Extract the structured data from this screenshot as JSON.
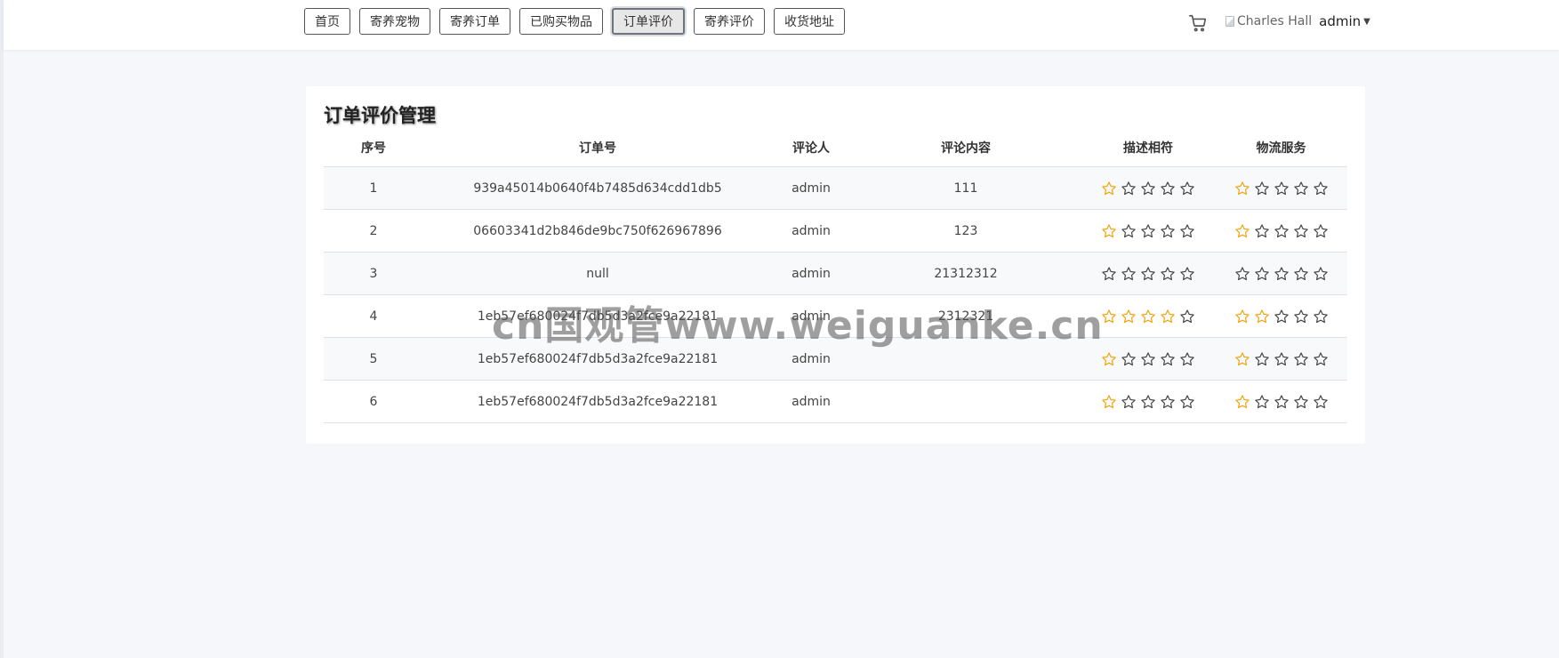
{
  "nav": [
    {
      "label": "首页",
      "active": false
    },
    {
      "label": "寄养宠物",
      "active": false
    },
    {
      "label": "寄养订单",
      "active": false
    },
    {
      "label": "已购买物品",
      "active": false
    },
    {
      "label": "订单评价",
      "active": true
    },
    {
      "label": "寄养评价",
      "active": false
    },
    {
      "label": "收货地址",
      "active": false
    }
  ],
  "header": {
    "cart_icon": "cart-icon",
    "avatar_alt": "Charles Hall",
    "username": "admin"
  },
  "page": {
    "title": "订单评价管理",
    "columns": [
      "序号",
      "订单号",
      "评论人",
      "评论内容",
      "描述相符",
      "物流服务"
    ],
    "rows": [
      {
        "index": "1",
        "order_no": "939a45014b0640f4b7485d634cdd1db5",
        "reviewer": "admin",
        "content": "111",
        "description_rating": 1,
        "logistics_rating": 1
      },
      {
        "index": "2",
        "order_no": "06603341d2b846de9bc750f626967896",
        "reviewer": "admin",
        "content": "123",
        "description_rating": 1,
        "logistics_rating": 1
      },
      {
        "index": "3",
        "order_no": "null",
        "reviewer": "admin",
        "content": "21312312",
        "description_rating": 0,
        "logistics_rating": 0
      },
      {
        "index": "4",
        "order_no": "1eb57ef680024f7db5d3a2fce9a22181",
        "reviewer": "admin",
        "content": "2312321",
        "description_rating": 4,
        "logistics_rating": 2
      },
      {
        "index": "5",
        "order_no": "1eb57ef680024f7db5d3a2fce9a22181",
        "reviewer": "admin",
        "content": "",
        "description_rating": 1,
        "logistics_rating": 1
      },
      {
        "index": "6",
        "order_no": "1eb57ef680024f7db5d3a2fce9a22181",
        "reviewer": "admin",
        "content": "",
        "description_rating": 1,
        "logistics_rating": 1
      }
    ],
    "max_stars": 5
  },
  "watermark": "cn国观管www.weiguanke.cn",
  "colors": {
    "star_filled": "#f0a30a",
    "star_empty": "#444444"
  }
}
